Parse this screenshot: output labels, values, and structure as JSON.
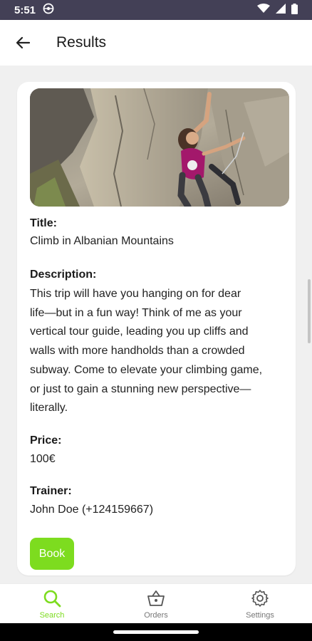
{
  "status": {
    "time": "5:51"
  },
  "header": {
    "title": "Results"
  },
  "trip": {
    "title_label": "Title:",
    "title": "Climb in Albanian Mountains",
    "description_label": "Description:",
    "description_lines": [
      "This trip will have you hanging on for dear",
      "life—but in a fun way! Think of me as your",
      "vertical tour guide, leading you up cliffs and",
      "walls with more handholds than a crowded",
      "subway. Come to elevate your climbing game,",
      "or just to gain a stunning new perspective—",
      "literally."
    ],
    "price_label": "Price:",
    "price": "100€",
    "trainer_label": "Trainer:",
    "trainer": "John Doe (+124159667)",
    "book_label": "Book"
  },
  "bottom_nav": {
    "items": [
      {
        "label": "Search",
        "icon": "search-icon",
        "active": true
      },
      {
        "label": "Orders",
        "icon": "basket-icon",
        "active": false
      },
      {
        "label": "Settings",
        "icon": "gear-icon",
        "active": false
      }
    ]
  },
  "colors": {
    "accent": "#7ddc1f",
    "status_bar": "#434056",
    "background": "#f0f0f0"
  }
}
